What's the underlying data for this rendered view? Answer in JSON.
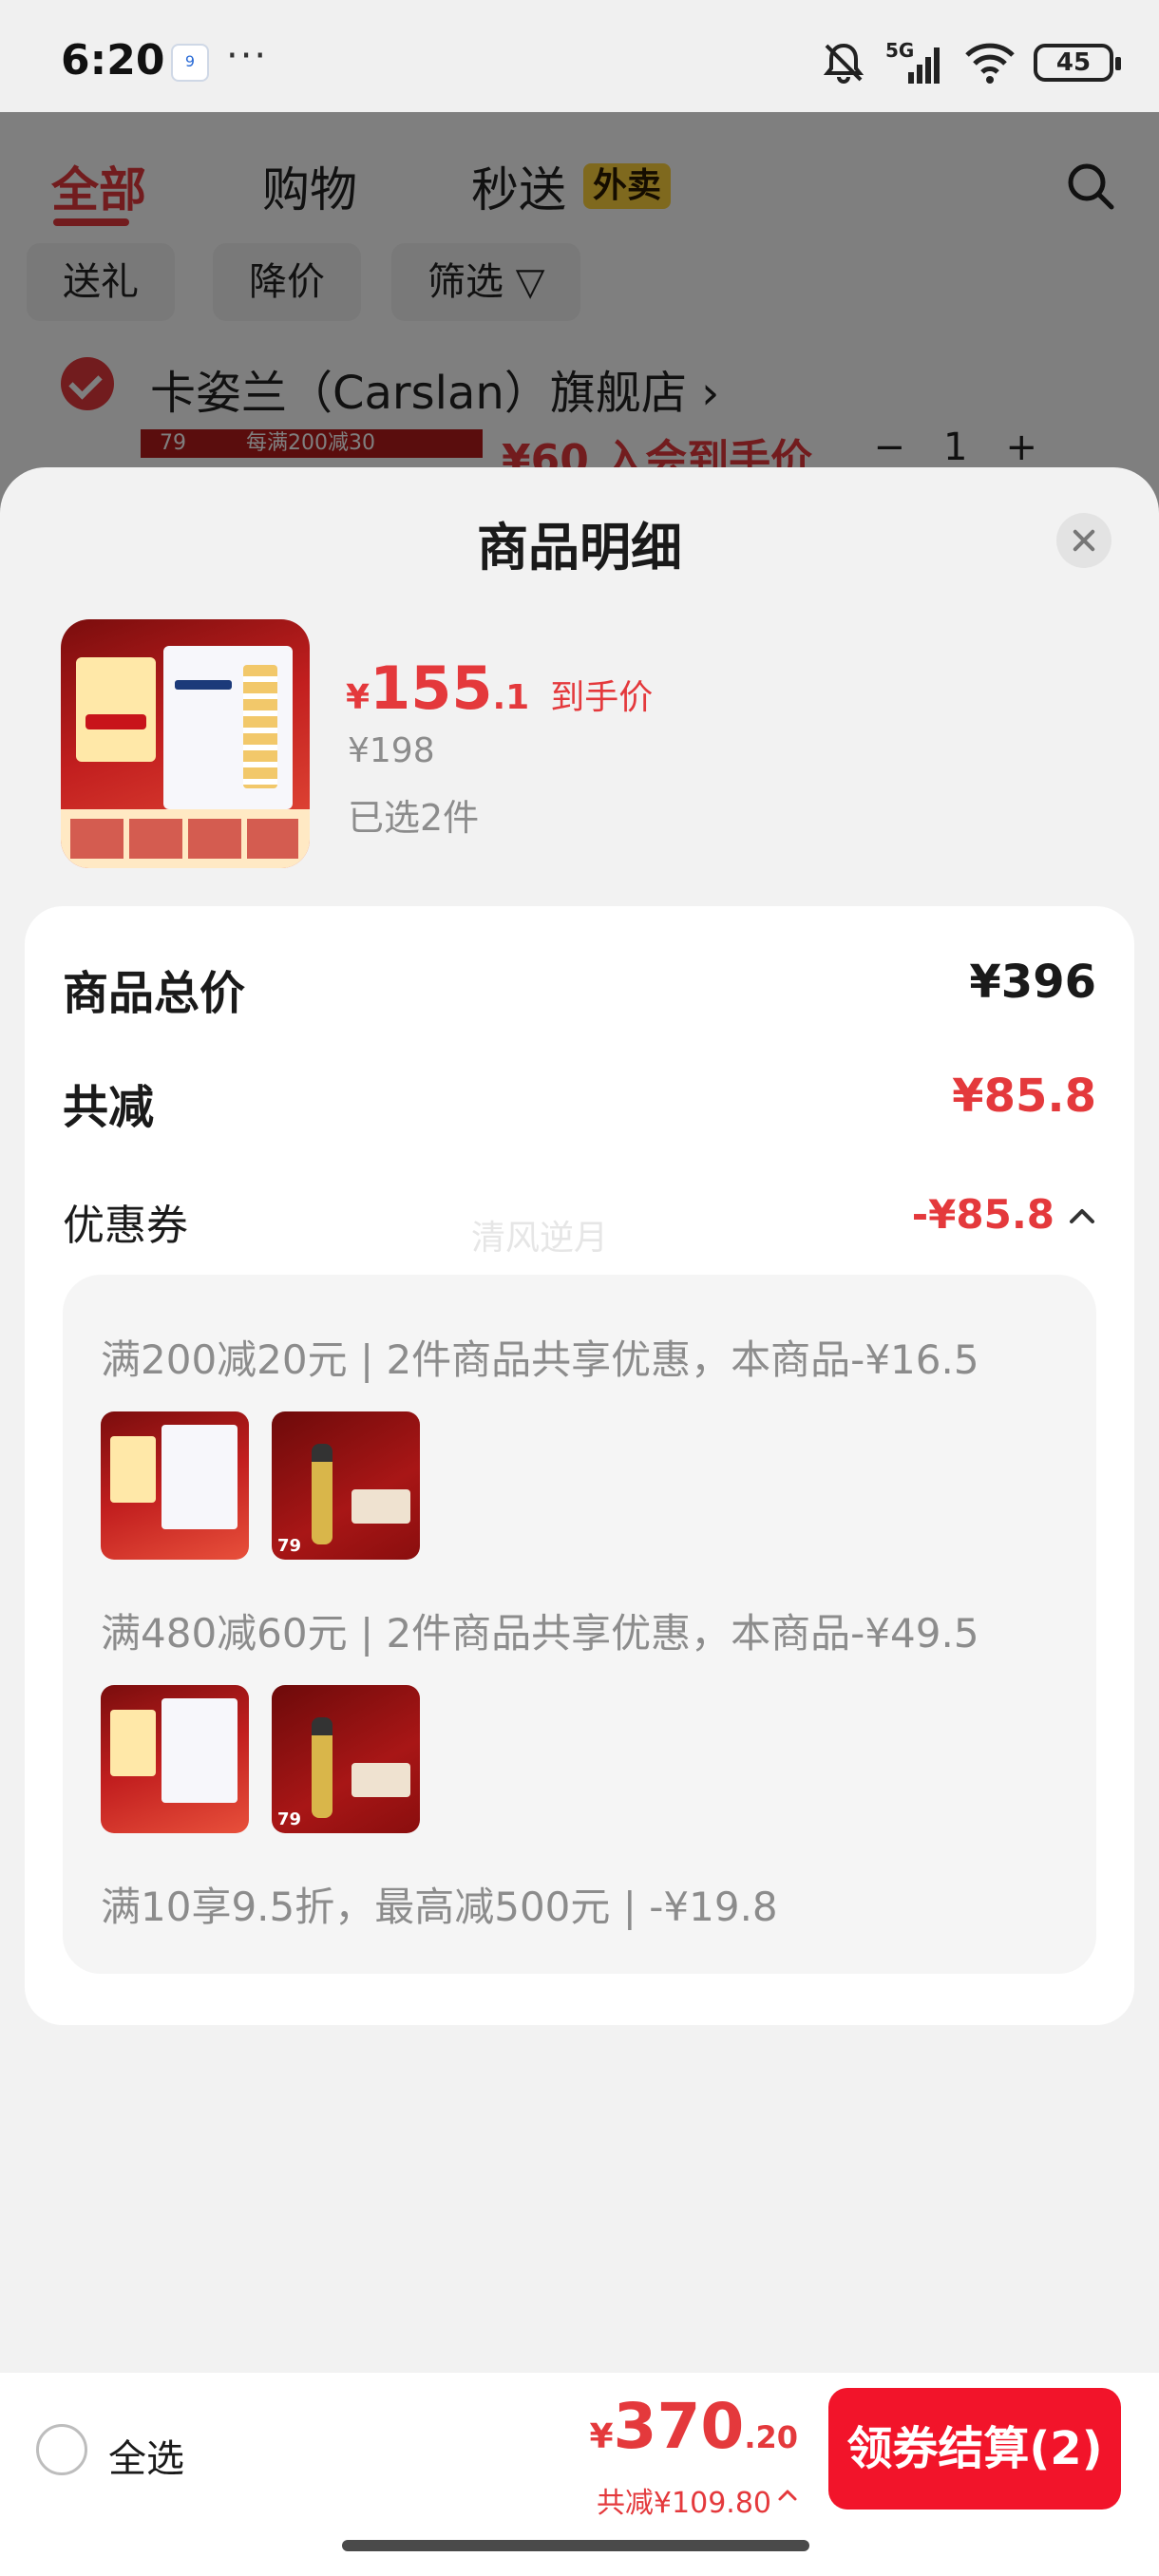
{
  "status_bar": {
    "time": "6:20",
    "calendar_day": "9",
    "more": "···",
    "network": "5G",
    "battery": "45"
  },
  "background_page": {
    "tabs": [
      {
        "label": "全部"
      },
      {
        "label": "购物"
      },
      {
        "label": "秒送"
      }
    ],
    "waimai_badge": "外卖",
    "chips": [
      {
        "label": "送礼"
      },
      {
        "label": "降价"
      },
      {
        "label": "筛选 ▽"
      }
    ],
    "store_name": "卡姿兰（Carslan）旗舰店 ›",
    "partial_price": "¥60 入会到手价",
    "quantity": "1",
    "strip_left": "79",
    "strip_right": "每满200减30"
  },
  "sheet": {
    "title": "商品明细",
    "product": {
      "price_yen": "¥",
      "price_int": "155",
      "price_dec": ".1",
      "price_tag": "到手价",
      "original_price": "¥198",
      "selected_count": "已选2件"
    },
    "summary": {
      "total_label": "商品总价",
      "total_value": "¥396",
      "reduction_label": "共减",
      "reduction_value": "¥85.8",
      "coupon_label": "优惠券",
      "coupon_value": "-¥85.8",
      "watermark": "清风逆月"
    },
    "coupons": [
      {
        "text": "满200减20元 | 2件商品共享优惠，本商品-¥16.5",
        "thumb_tag": "79"
      },
      {
        "text": "满480减60元 | 2件商品共享优惠，本商品-¥49.5",
        "thumb_tag": "79"
      },
      {
        "text": "满10享9.5折，最高减500元 | -¥19.8"
      }
    ]
  },
  "checkout": {
    "select_all": "全选",
    "total_yen": "¥",
    "total_int": "370",
    "total_dec": ".20",
    "saved": "共减¥109.80",
    "button": "领券结算(2)"
  },
  "colors": {
    "accent": "#e4393c",
    "checkout_button": "#f2142a",
    "sheet_bg": "#f2f2f2"
  },
  "icons": [
    "silent-bell-icon",
    "signal-icon",
    "wifi-icon",
    "battery-icon",
    "search-icon",
    "close-icon",
    "chevron-up-icon",
    "checkbox-icon"
  ]
}
